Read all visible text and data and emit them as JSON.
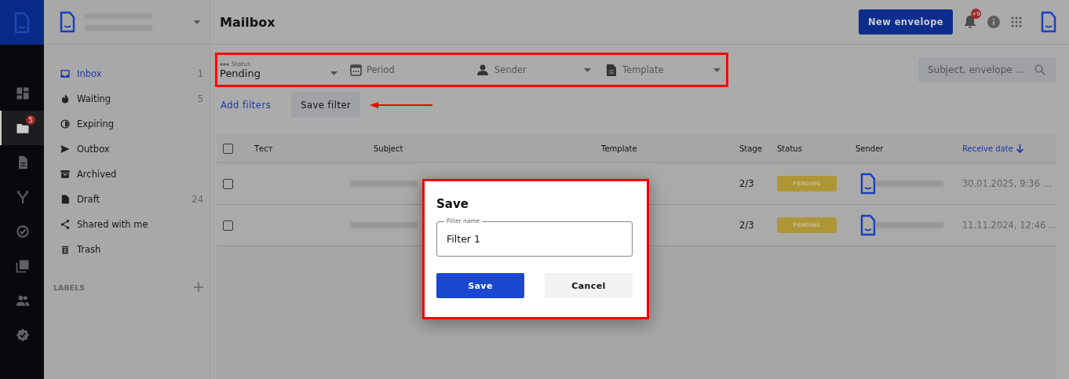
{
  "rail": {
    "items": [
      {
        "selected": false
      },
      {
        "selected": true,
        "badge": "5"
      },
      {
        "selected": false
      },
      {
        "selected": false
      },
      {
        "selected": false
      },
      {
        "selected": false
      },
      {
        "selected": false
      },
      {
        "selected": false
      }
    ]
  },
  "sidebar": {
    "items": [
      {
        "label": "Inbox",
        "count": "1",
        "selected": true
      },
      {
        "label": "Waiting",
        "count": "5",
        "selected": false
      },
      {
        "label": "Expiring",
        "selected": false
      },
      {
        "label": "Outbox",
        "selected": false
      },
      {
        "label": "Archived",
        "selected": false
      },
      {
        "label": "Draft",
        "count": "24",
        "selected": false
      },
      {
        "label": "Shared with me",
        "selected": false
      },
      {
        "label": "Trash",
        "selected": false
      }
    ],
    "labels_heading": "LABELS"
  },
  "header": {
    "title": "Mailbox",
    "new_button": "New envelope",
    "notifications_badge": "+9"
  },
  "filters": {
    "status": {
      "label": "Status",
      "value": "Pending"
    },
    "period": {
      "placeholder": "Period"
    },
    "sender": {
      "placeholder": "Sender"
    },
    "template": {
      "placeholder": "Template"
    },
    "search": {
      "placeholder": "Subject, envelope ..."
    },
    "add_filters": "Add filters",
    "save_filter": "Save filter"
  },
  "table": {
    "columns": [
      {
        "label": "Тест",
        "sorted": false
      },
      {
        "label": "Subject",
        "sorted": false
      },
      {
        "label": "Template",
        "sorted": false
      },
      {
        "label": "Stage",
        "sorted": false
      },
      {
        "label": "Status",
        "sorted": false
      },
      {
        "label": "Sender",
        "sorted": false
      },
      {
        "label": "Receive date",
        "sorted": true
      }
    ],
    "header_checked": false,
    "rows": [
      {
        "checked": false,
        "stage": "2/3",
        "status": "PENDING",
        "date": "30.01.2025, 9:36 ..."
      },
      {
        "checked": false,
        "stage": "2/3",
        "status": "PENDING",
        "date": "11.11.2024, 12:46 ..."
      }
    ]
  },
  "dialog": {
    "title": "Save",
    "field_label": "Filter name",
    "field_value": "Filter 1",
    "save": "Save",
    "cancel": "Cancel"
  }
}
